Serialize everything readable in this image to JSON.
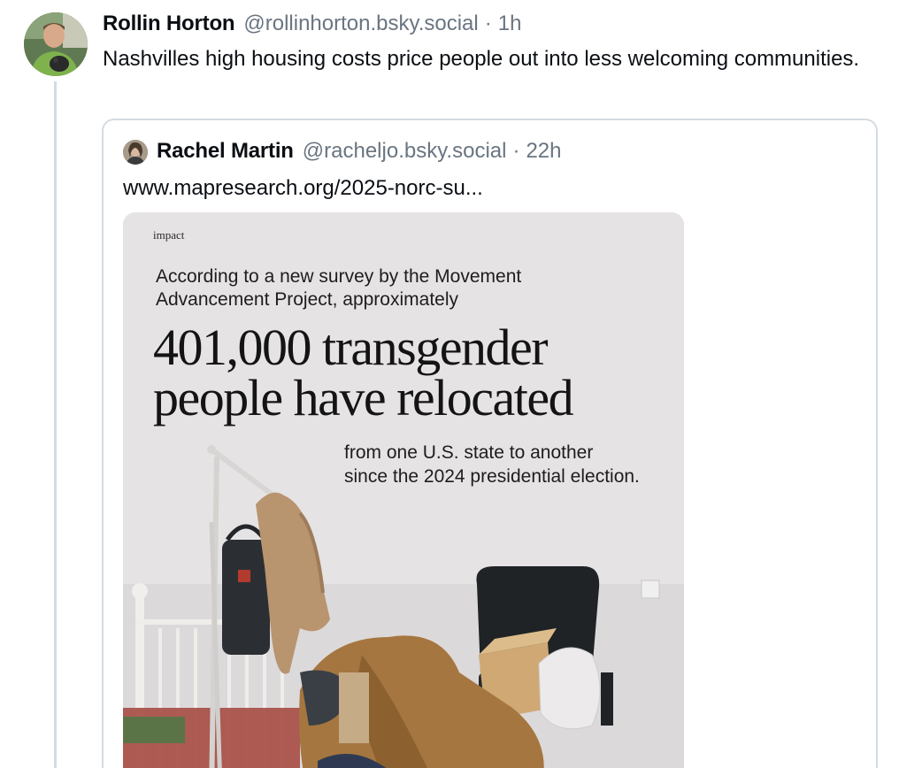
{
  "post": {
    "author_name": "Rollin Horton",
    "author_handle": "@rollinhorton.bsky.social",
    "separator": "·",
    "time": "1h",
    "text": "Nashvilles high housing costs price people out into less welcoming communities."
  },
  "quote": {
    "author_name": "Rachel Martin",
    "author_handle": "@racheljo.bsky.social",
    "separator": "·",
    "time": "22h",
    "link_text": "www.mapresearch.org/2025-norc-su..."
  },
  "embed": {
    "brand": "impact",
    "intro": "According to a new survey by the Movement Advancement Project, approximately",
    "headline_line1": "401,000 transgender",
    "headline_line2": "people have relocated",
    "sub_line1": "from one U.S. state to another",
    "sub_line2": "since the 2024 presidential election."
  },
  "colors": {
    "text": "#0b0f14",
    "muted": "#6a7581",
    "border": "#d4dbe2"
  }
}
